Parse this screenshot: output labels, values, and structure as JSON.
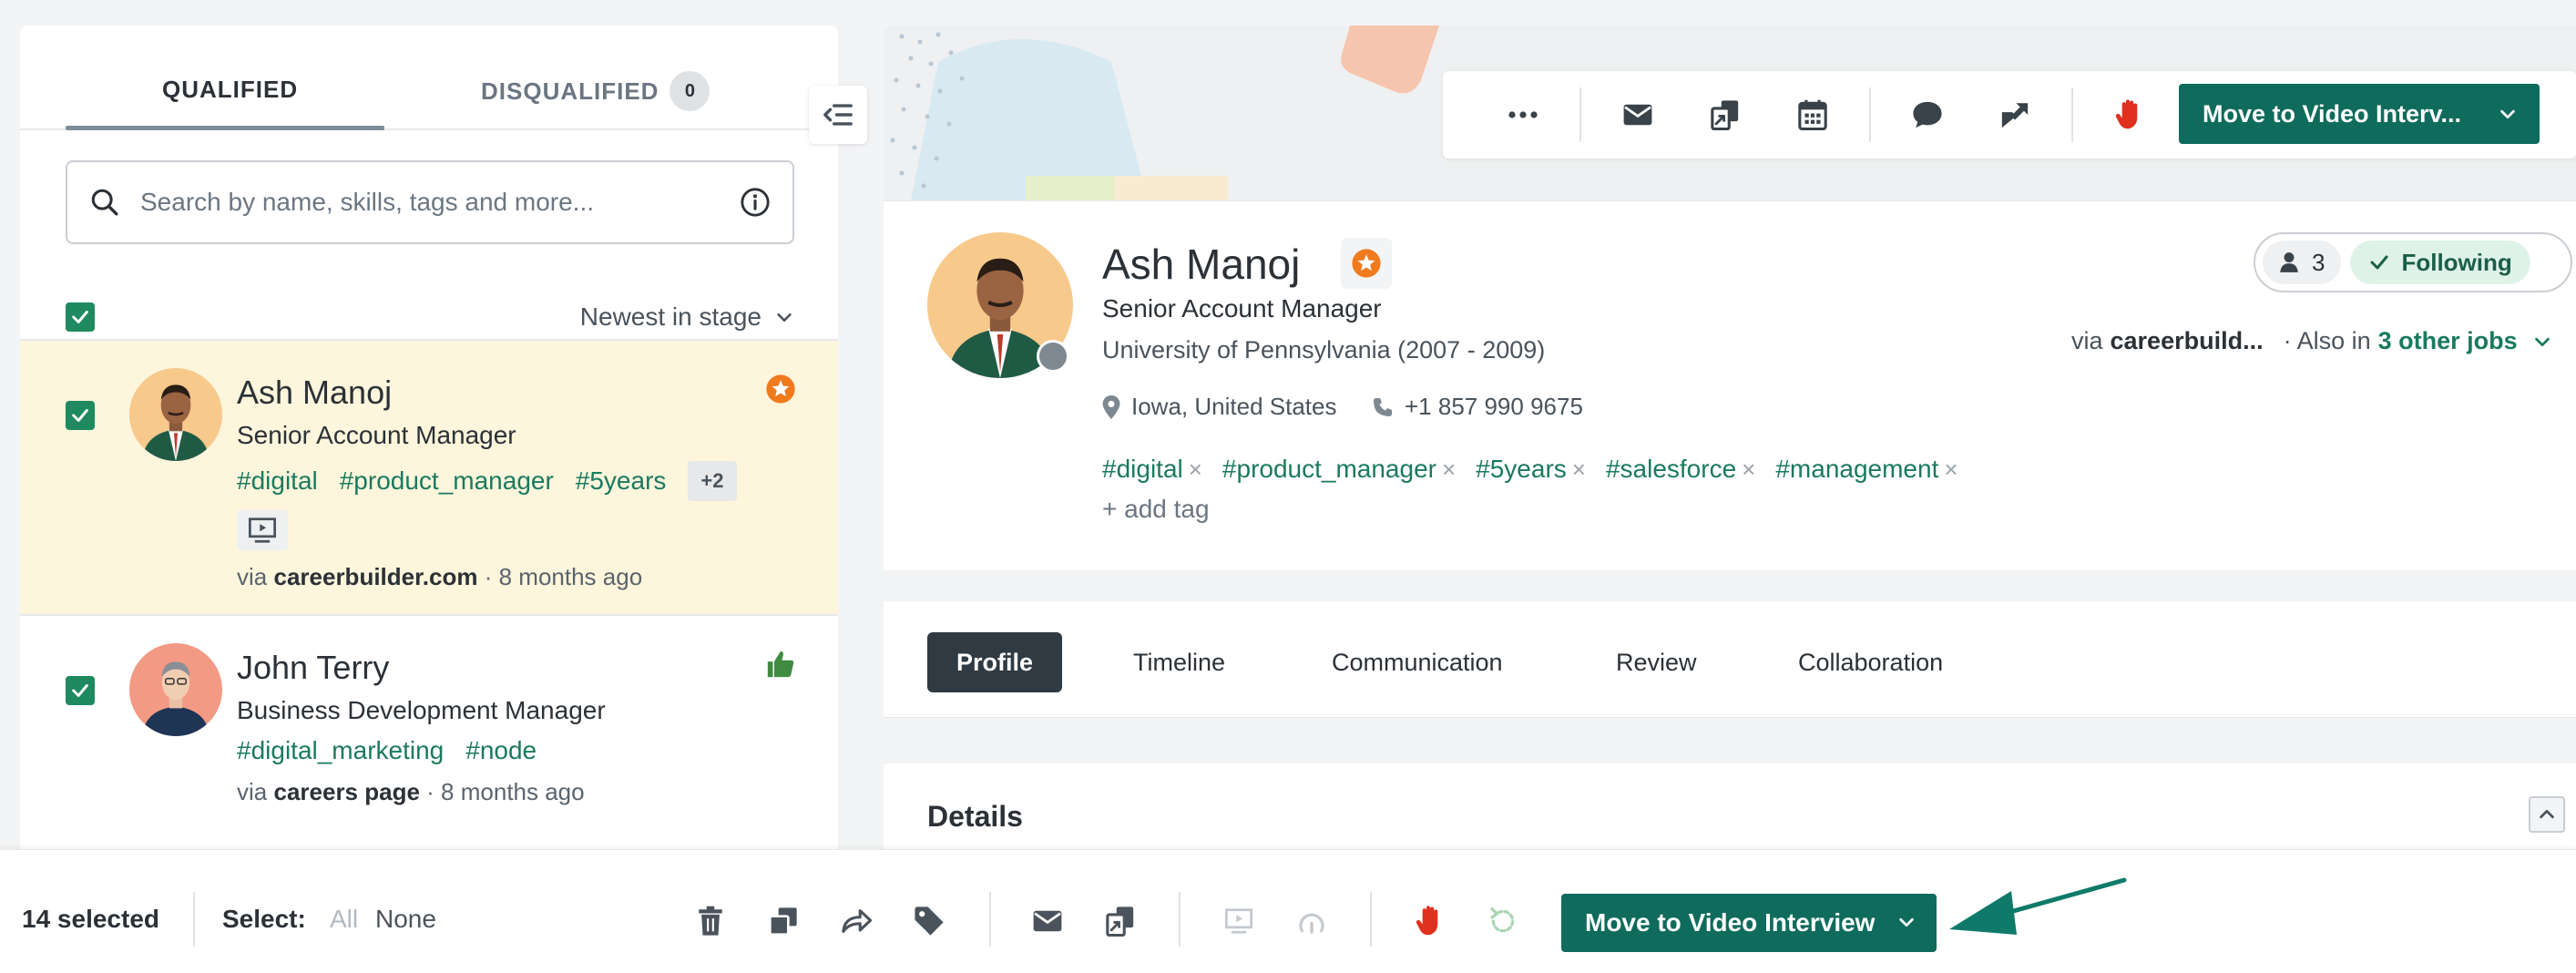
{
  "left": {
    "tabs": {
      "qualified": "QUALIFIED",
      "disqualified": "DISQUALIFIED",
      "disqualified_count": "0"
    },
    "search": {
      "placeholder": "Search by name, skills, tags and more..."
    },
    "sort": {
      "label": "Newest in stage"
    },
    "candidates": [
      {
        "name": "Ash Manoj",
        "title": "Senior Account Manager",
        "tags": [
          "#digital",
          "#product_manager",
          "#5years"
        ],
        "more_tags": "+2",
        "via_prefix": "via",
        "via_source": "careerbuilder.com",
        "via_time": "· 8 months ago"
      },
      {
        "name": "John Terry",
        "title": "Business Development Manager",
        "tags": [
          "#digital_marketing",
          "#node"
        ],
        "via_prefix": "via",
        "via_source": "careers page",
        "via_time": "· 8 months ago"
      }
    ]
  },
  "header": {
    "primary_action": "Move to Video Interv...",
    "icons": [
      "more-icon",
      "email-icon",
      "copy-icon",
      "calendar-icon",
      "comment-icon",
      "share-icon",
      "stop-hand-icon"
    ]
  },
  "profile": {
    "name": "Ash Manoj",
    "title": "Senior Account Manager",
    "education": "University of Pennsylvania (2007 - 2009)",
    "location": "Iowa, United States",
    "phone": "+1 857 990 9675",
    "tags": [
      "#digital",
      "#product_manager",
      "#5years",
      "#salesforce",
      "#management"
    ],
    "add_tag": "+  add tag",
    "watchers": "3",
    "following": "Following",
    "via_prefix": "via",
    "via_source": "careerbuild...",
    "also_in": "· Also in",
    "other_jobs": "3 other jobs"
  },
  "profile_tabs": [
    "Profile",
    "Timeline",
    "Communication",
    "Review",
    "Collaboration"
  ],
  "details": {
    "title": "Details"
  },
  "bottom": {
    "selected": "14 selected",
    "select_label": "Select:",
    "all": "All",
    "none": "None",
    "primary_action": "Move to Video Interview"
  },
  "colors": {
    "brand": "#0f6b5c",
    "tag": "#1a7a5e",
    "checkbox": "#1f8a5f",
    "highlight": "#fdf5dc",
    "stop": "#e0301e",
    "star": "#f07a1e"
  }
}
